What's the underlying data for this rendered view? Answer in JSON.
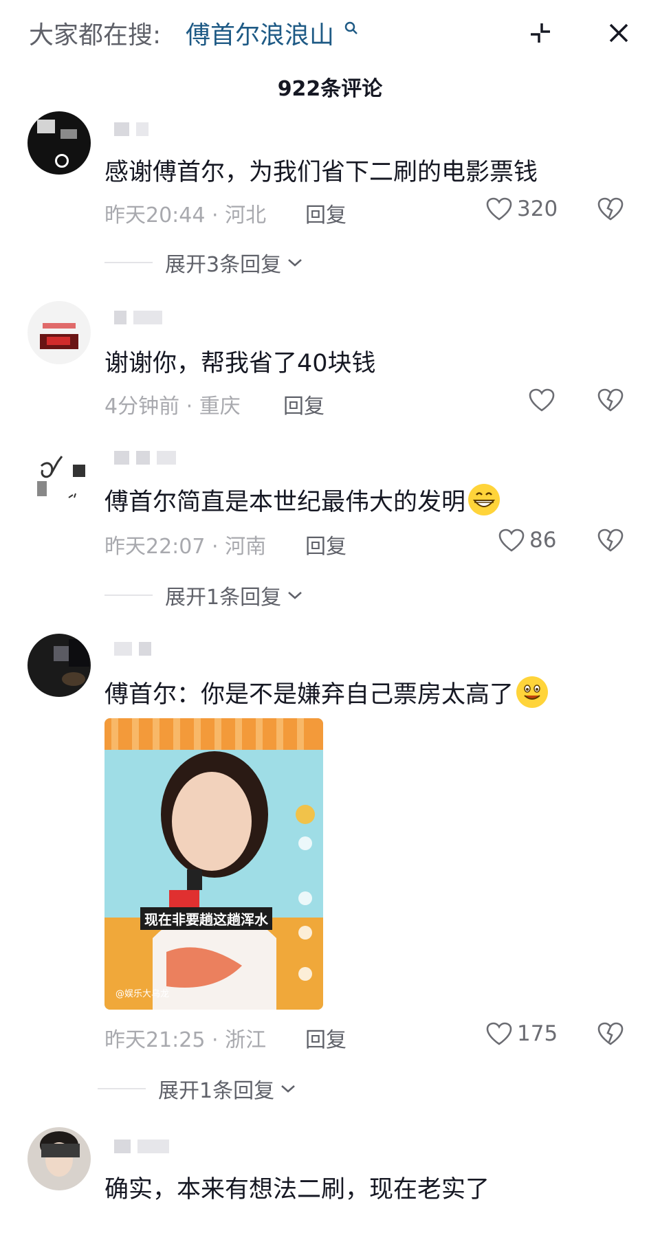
{
  "header": {
    "search_prefix": "大家都在搜:",
    "search_term": "傅首尔浪浪山",
    "comment_count_title": "922条评论"
  },
  "comments": [
    {
      "text": "感谢傅首尔，为我们省下二刷的电影票钱",
      "time": "昨天20:44",
      "location": "河北",
      "reply_label": "回复",
      "likes": "320",
      "expand_label": "展开3条回复"
    },
    {
      "text": "谢谢你，帮我省了40块钱",
      "time": "4分钟前",
      "location": "重庆",
      "reply_label": "回复",
      "likes": ""
    },
    {
      "text": "傅首尔简直是本世纪最伟大的发明",
      "time": "昨天22:07",
      "location": "河南",
      "reply_label": "回复",
      "likes": "86",
      "expand_label": "展开1条回复",
      "emoji": "grinning-emoji"
    },
    {
      "text": "傅首尔：你是不是嫌弃自己票房太高了",
      "time": "昨天21:25",
      "location": "浙江",
      "reply_label": "回复",
      "likes": "175",
      "expand_label": "展开1条回复",
      "emoji": "smiling-emoji",
      "video": {
        "caption": "现在非要趟这趟浑水",
        "brand": "@娱乐大乌龙"
      }
    },
    {
      "text": "确实，本来有想法二刷，现在老实了"
    }
  ],
  "colors": {
    "search_term": "#1e5a85",
    "meta_gray": "#a8a9ae",
    "text_dark": "#161823"
  }
}
